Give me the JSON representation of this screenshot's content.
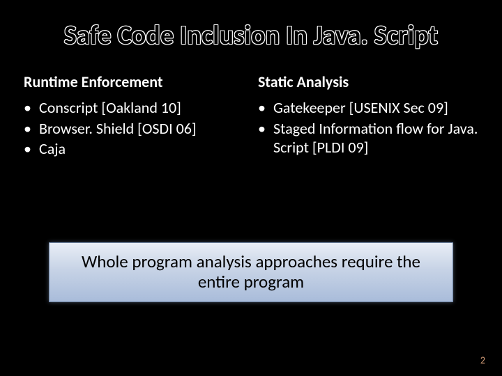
{
  "title": "Safe Code Inclusion In Java. Script",
  "left": {
    "heading": "Runtime Enforcement",
    "items": [
      "Conscript [Oakland 10]",
      "Browser. Shield [OSDI 06]",
      "Caja"
    ]
  },
  "right": {
    "heading": "Static Analysis",
    "items": [
      "Gatekeeper [USENIX Sec 09]",
      "Staged Information flow for Java. Script [PLDI 09]"
    ]
  },
  "banner": "Whole program analysis approaches require the entire program",
  "page": "2"
}
